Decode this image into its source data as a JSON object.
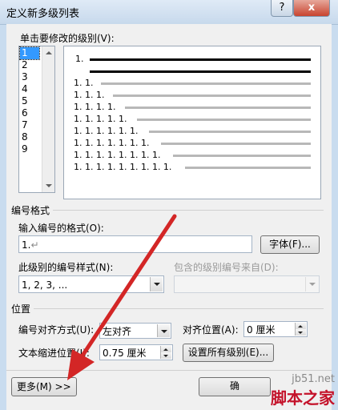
{
  "window": {
    "title": "定义新多级列表",
    "help_label": "?",
    "close_label": "x"
  },
  "levels": {
    "label": "单击要修改的级别(V):",
    "items": [
      "1",
      "2",
      "3",
      "4",
      "5",
      "6",
      "7",
      "8",
      "9"
    ],
    "selected": "1"
  },
  "preview": {
    "rows": [
      "1.",
      "",
      "1. 1.",
      "1. 1. 1.",
      "1. 1. 1. 1.",
      "1. 1. 1. 1. 1.",
      "1. 1. 1. 1. 1. 1.",
      "1. 1. 1. 1. 1. 1. 1.",
      "1. 1. 1. 1. 1. 1. 1. 1.",
      "1. 1. 1. 1. 1. 1. 1. 1. 1."
    ]
  },
  "number_format": {
    "section_label": "编号格式",
    "format_label": "输入编号的格式(O):",
    "format_value": "1.",
    "font_button": "字体(F)...",
    "style_label": "此级别的编号样式(N):",
    "style_value": "1, 2, 3, ...",
    "include_label": "包含的级别编号来自(D):",
    "include_value": ""
  },
  "position": {
    "section_label": "位置",
    "align_label": "编号对齐方式(U):",
    "align_value": "左对齐",
    "align_at_label": "对齐位置(A):",
    "align_at_value": "0 厘米",
    "indent_label": "文本缩进位置(I):",
    "indent_value": "0.75 厘米",
    "set_all_button": "设置所有级别(E)..."
  },
  "footer": {
    "more_button": "更多(M) >>",
    "ok_button": "确"
  },
  "watermark": {
    "line1": "jb51.net",
    "line2": "脚本之家"
  },
  "colors": {
    "arrow": "#d32626",
    "selection": "#3399ff"
  }
}
